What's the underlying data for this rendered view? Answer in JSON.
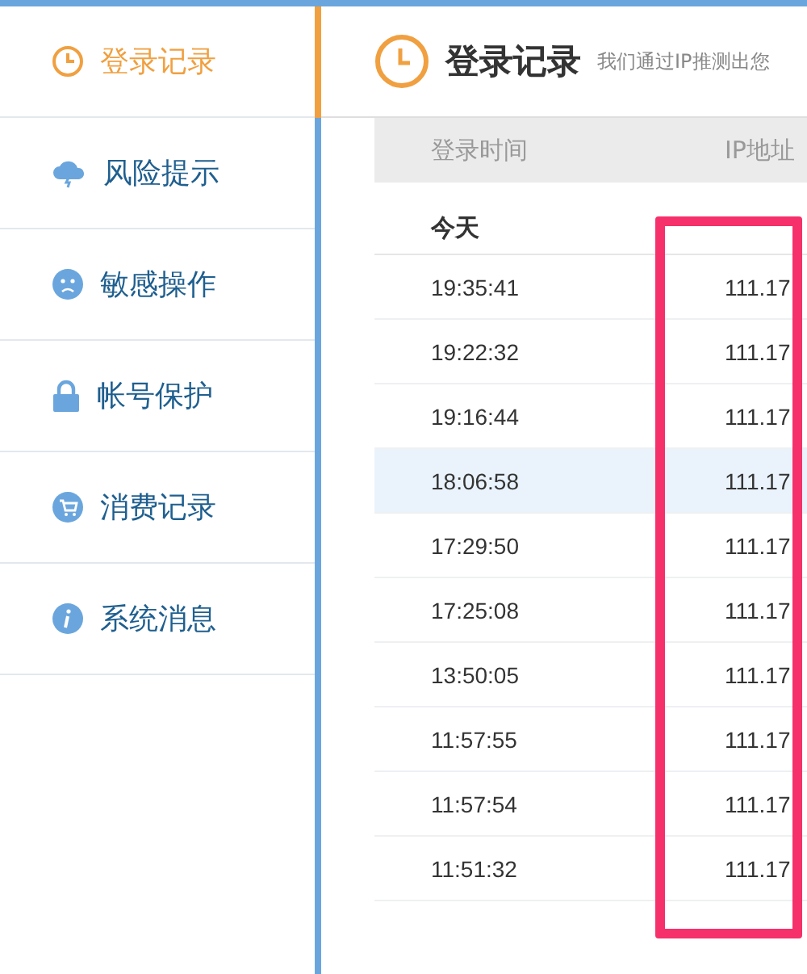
{
  "sidebar": {
    "items": [
      {
        "label": "登录记录",
        "selected": true
      },
      {
        "label": "风险提示",
        "selected": false
      },
      {
        "label": "敏感操作",
        "selected": false
      },
      {
        "label": "帐号保护",
        "selected": false
      },
      {
        "label": "消费记录",
        "selected": false
      },
      {
        "label": "系统消息",
        "selected": false
      }
    ]
  },
  "header": {
    "title": "登录记录",
    "subtitle": "我们通过IP推测出您"
  },
  "table": {
    "columns": [
      "登录时间",
      "IP地址"
    ],
    "group": "今天",
    "rows": [
      {
        "time": "19:35:41",
        "ip": "111.17",
        "selected": false
      },
      {
        "time": "19:22:32",
        "ip": "111.17",
        "selected": false
      },
      {
        "time": "19:16:44",
        "ip": "111.17",
        "selected": false
      },
      {
        "time": "18:06:58",
        "ip": "111.17",
        "selected": true
      },
      {
        "time": "17:29:50",
        "ip": "111.17",
        "selected": false
      },
      {
        "time": "17:25:08",
        "ip": "111.17",
        "selected": false
      },
      {
        "time": "13:50:05",
        "ip": "111.17",
        "selected": false
      },
      {
        "time": "11:57:55",
        "ip": "111.17",
        "selected": false
      },
      {
        "time": "11:57:54",
        "ip": "111.17",
        "selected": false
      },
      {
        "time": "11:51:32",
        "ip": "111.17",
        "selected": false
      }
    ]
  }
}
